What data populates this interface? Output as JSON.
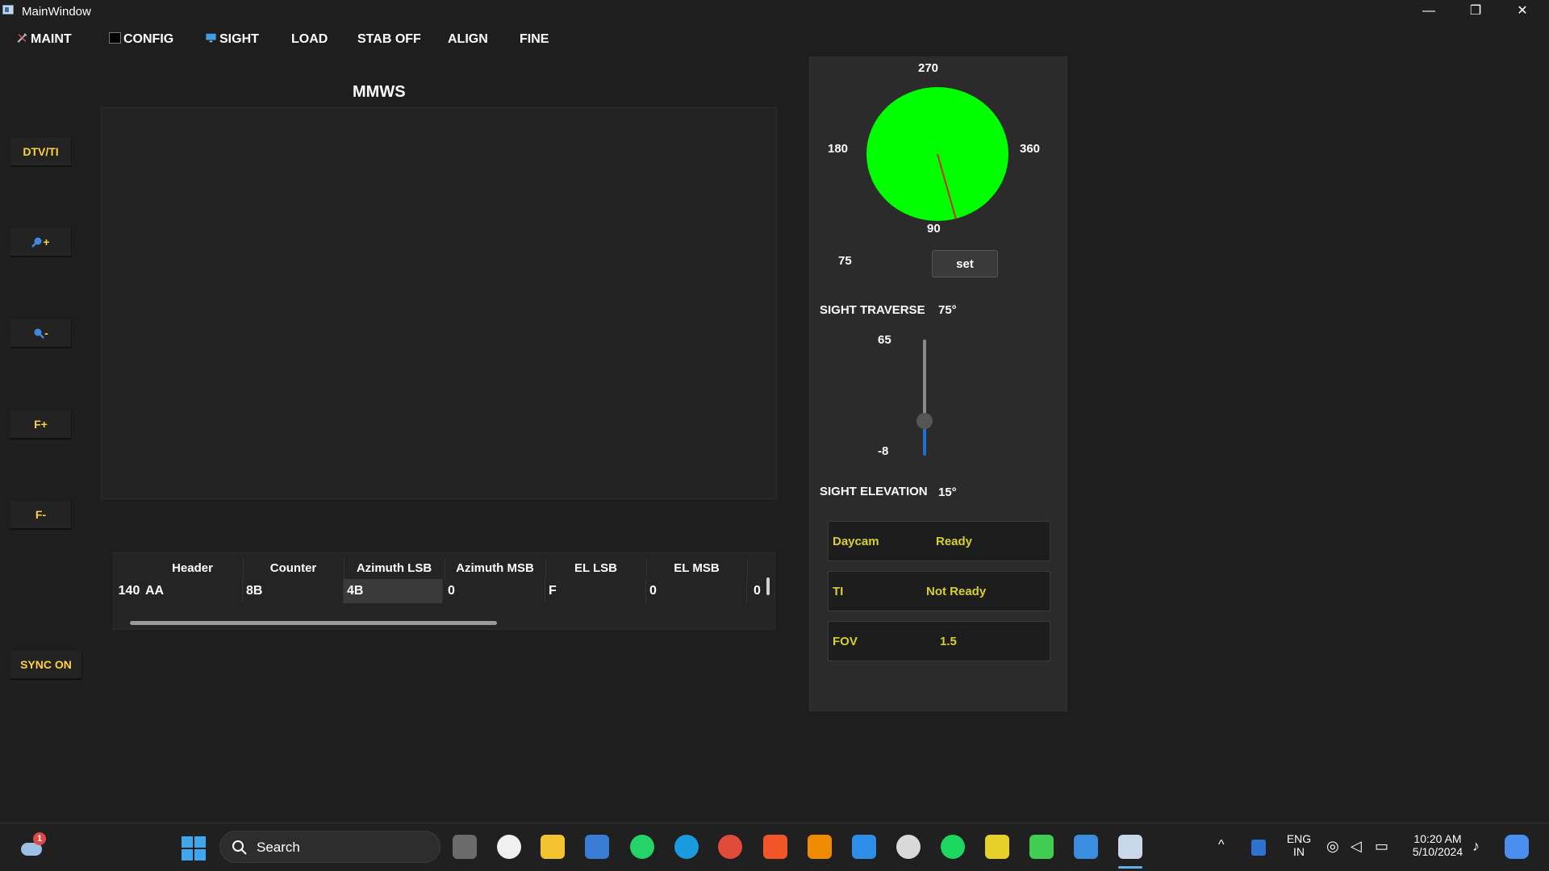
{
  "window": {
    "title": "MainWindow",
    "minimize": "—",
    "maximize": "❐",
    "close": "✕"
  },
  "menu": {
    "maint": "MAINT",
    "config": "CONFIG",
    "sight": "SIGHT",
    "load": "LOAD",
    "stab": "STAB OFF",
    "align": "ALIGN",
    "fine": "FINE"
  },
  "side_buttons": {
    "dtv_ti": "DTV/TI",
    "zoom_in": "+",
    "zoom_out": "-",
    "focus_plus": "F+",
    "focus_minus": "F-",
    "sync": "SYNC ON"
  },
  "mmws": {
    "title": "MMWS"
  },
  "table": {
    "headers": [
      "Header",
      "Counter",
      "Azimuth LSB",
      "Azimuth MSB",
      "EL LSB",
      "EL MSB"
    ],
    "row_header": "140",
    "row": [
      "AA",
      "8B",
      "4B",
      "0",
      "F",
      "0",
      "0"
    ]
  },
  "compass": {
    "label_top": "270",
    "label_left": "180",
    "label_right": "360",
    "label_bottom": "90",
    "value": "75",
    "pointer_value_deg": 75,
    "set_label": "set",
    "fill_color": "#00ff00",
    "pointer_color": "#d22a1e"
  },
  "traverse": {
    "label": "SIGHT TRAVERSE",
    "value": "75°"
  },
  "elevation_slider": {
    "max_label": "65",
    "min_label": "-8",
    "level": 15
  },
  "elevation": {
    "label": "SIGHT ELEVATION",
    "value": "15°"
  },
  "status": {
    "daycam_label": "Daycam",
    "daycam_value": "Ready",
    "ti_label": "TI",
    "ti_value": "Not Ready",
    "fov_label": "FOV",
    "fov_value": "1.5"
  },
  "taskbar": {
    "search": "Search",
    "notification_count": "1",
    "lang_line1": "ENG",
    "lang_line2": "IN",
    "time": "10:20 AM",
    "date": "5/10/2024"
  }
}
